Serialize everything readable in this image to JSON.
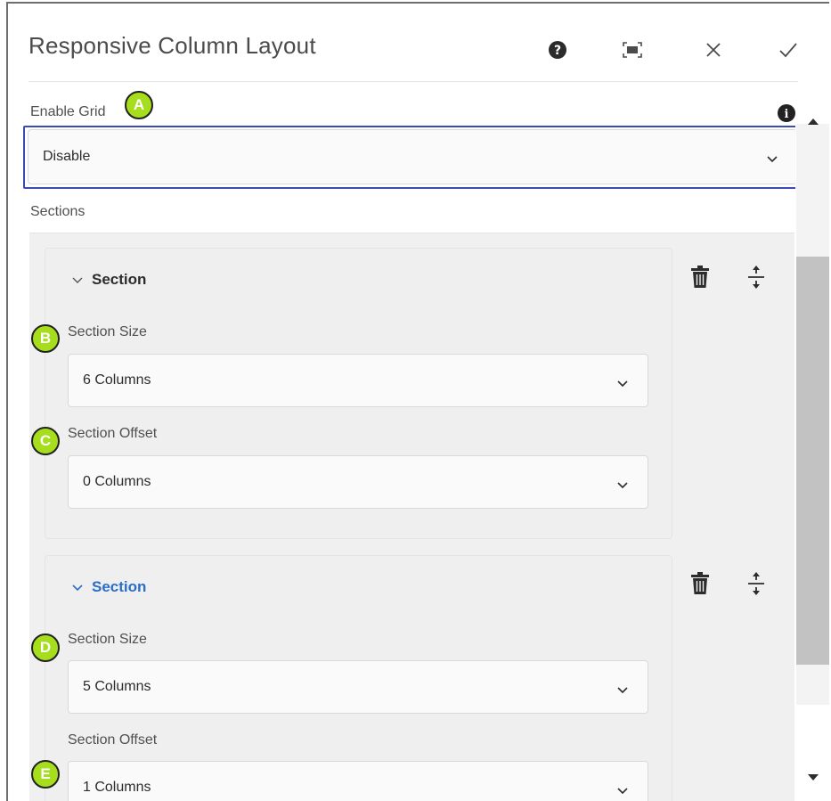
{
  "dialog": {
    "title": "Responsive Column Layout",
    "icons": [
      "help-icon",
      "fullscreen-icon",
      "close-icon",
      "checkmark-icon"
    ]
  },
  "enable_grid": {
    "label": "Enable Grid",
    "value": "Disable",
    "marker": "A"
  },
  "sections_label": "Sections",
  "sections": [
    {
      "header": "Section",
      "size_label": "Section Size",
      "size_value": "6 Columns",
      "size_marker": "B",
      "offset_label": "Section Offset",
      "offset_value": "0 Columns",
      "offset_marker": "C"
    },
    {
      "header": "Section",
      "size_label": "Section Size",
      "size_value": "5 Columns",
      "size_marker": "D",
      "offset_label": "Section Offset",
      "offset_value": "1 Columns",
      "offset_marker": "E"
    }
  ],
  "colors": {
    "marker_fill": "#a6dd1c",
    "focus_ring": "#3a4bb5",
    "active_section": "#2b6ec7"
  }
}
